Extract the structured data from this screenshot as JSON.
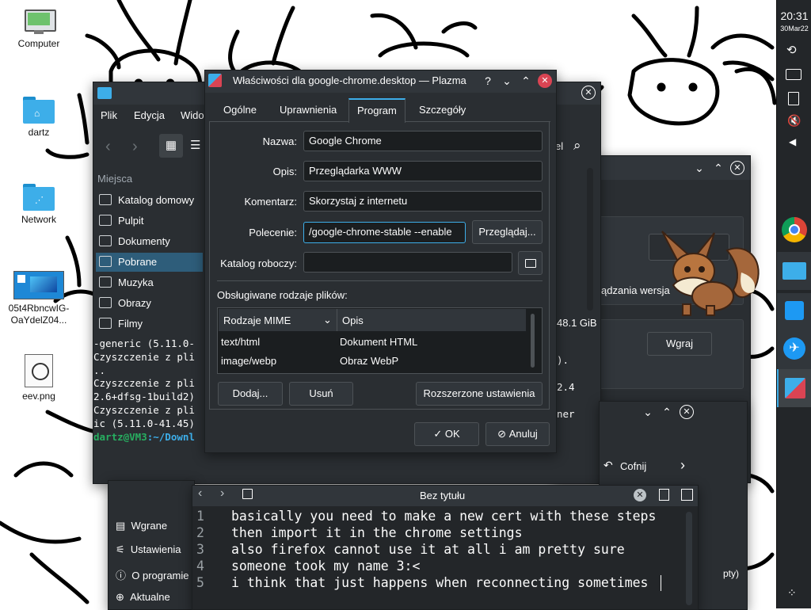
{
  "desktop": {
    "icons": [
      {
        "label": "Computer",
        "icon": "computer-icon"
      },
      {
        "label": "dartz",
        "icon": "home-folder-icon"
      },
      {
        "label": "Network",
        "icon": "network-folder-icon"
      },
      {
        "label": "05t4RbncwIG-OaYdelZ04...",
        "label_lines": [
          "05t4RbncwIG-",
          "OaYdelZ04..."
        ],
        "icon": "image-file-icon"
      },
      {
        "label": "eev.png",
        "icon": "image-file-icon"
      }
    ]
  },
  "dolphin": {
    "menu": [
      "Plik",
      "Edycja",
      "Widok"
    ],
    "places_header": "Miejsca",
    "places": [
      "Katalog domowy",
      "Pulpit",
      "Dokumenty",
      "Pobrane",
      "Muzyka",
      "Obrazy",
      "Filmy"
    ],
    "active_place": "Pobrane",
    "right_fragment_a": "el",
    "size_fragment": "48.1 GiB"
  },
  "terminal": {
    "lines": [
      "-generic (5.11.0-",
      "Czyszczenie z pli",
      "..",
      "Czyszczenie z pli",
      "2.6+dfsg-1build2)",
      "Czyszczenie z pli",
      "ic (5.11.0-41.45)"
    ],
    "prompt_user": "dartz@VM3",
    "prompt_path": ":~/Downl",
    "right_fragments": [
      ").",
      "2.4",
      "ner"
    ]
  },
  "discover": {
    "text_fragment": "ądzania wersja",
    "install_button": "Wgraj",
    "back_button": "Cofnij",
    "nav_items": [
      "Wgrane",
      "Ustawienia",
      "O programie",
      "Aktualne"
    ],
    "right_fragment": "pty)"
  },
  "properties_dialog": {
    "title": "Właściwości dla google-chrome.desktop — Plazma",
    "tabs": [
      "Ogólne",
      "Uprawnienia",
      "Program",
      "Szczegóły"
    ],
    "active_tab": "Program",
    "name_label": "Nazwa:",
    "name_value": "Google Chrome",
    "desc_label": "Opis:",
    "desc_value": "Przeglądarka WWW",
    "comment_label": "Komentarz:",
    "comment_value": "Skorzystaj z internetu",
    "command_label": "Polecenie:",
    "command_value": "/google-chrome-stable --enable",
    "browse_button": "Przeglądaj...",
    "workdir_label": "Katalog roboczy:",
    "workdir_value": "",
    "filetypes_label": "Obsługiwane rodzaje plików:",
    "mime_header": "Rodzaje MIME",
    "desc_header": "Opis",
    "mime_rows": [
      {
        "mime": "text/html",
        "desc": "Dokument HTML"
      },
      {
        "mime": "image/webp",
        "desc": "Obraz WebP"
      }
    ],
    "add_button": "Dodaj...",
    "remove_button": "Usuń",
    "advanced_button": "Rozszerzone ustawienia",
    "ok_button": "OK",
    "cancel_button": "Anuluj"
  },
  "editor": {
    "title": "Bez tytułu",
    "line_numbers": "1\n2\n3\n4\n5",
    "text": "basically you need to make a new cert with these steps\nthen import it in the chrome settings\nalso firefox cannot use it at all i am pretty sure\nsomeone took my name 3:<\ni think that just happens when reconnecting sometimes"
  },
  "panel": {
    "time": "20:31",
    "date": "30Mar22"
  },
  "colors": {
    "accent": "#3daee9",
    "window_bg": "#2a2e32",
    "titlebar": "#31363b",
    "close_red": "#da4453"
  }
}
